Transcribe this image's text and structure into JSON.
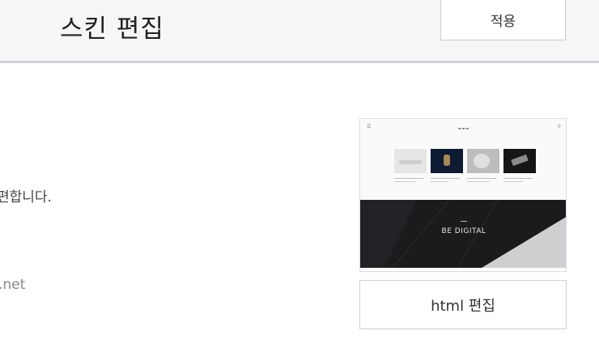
{
  "header": {
    "title": "스킨 편집",
    "apply_label": "적용"
  },
  "main": {
    "description_partial": "편합니다.",
    "domain_partial": ".net"
  },
  "preview": {
    "hero_tagline": "BE DIGITAL",
    "thumbnail_count": 4
  },
  "actions": {
    "html_edit_label": "html 편집"
  }
}
